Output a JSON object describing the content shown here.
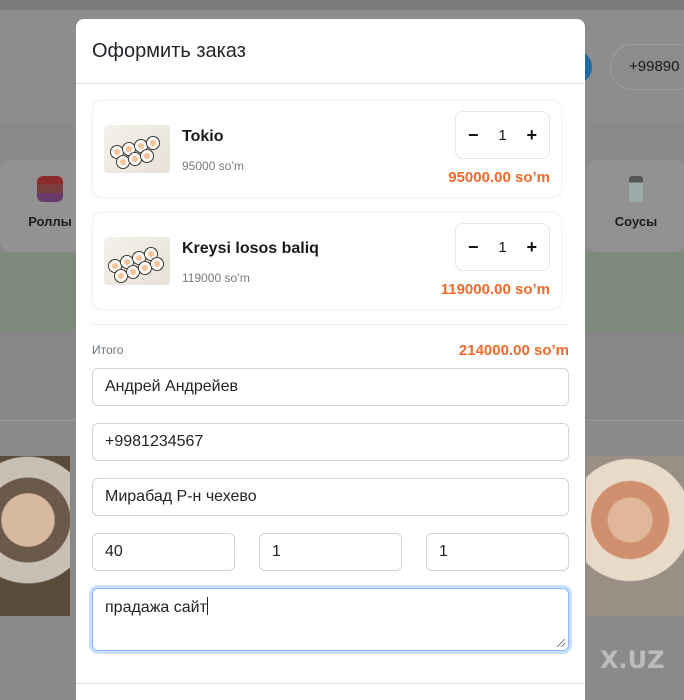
{
  "background": {
    "phone_partial": "+99890",
    "categories": [
      {
        "label": "Роллы",
        "icon": "sushi-roll-icon"
      },
      {
        "label": "Соусы",
        "icon": "sauce-bottle-icon"
      }
    ],
    "watermark": "X.UZ"
  },
  "modal": {
    "title": "Оформить заказ",
    "items": [
      {
        "name": "Tokio",
        "unit_price": "95000 so’m",
        "quantity": "1",
        "minus": "−",
        "plus": "+",
        "line_total": "95000.00 so’m"
      },
      {
        "name": "Kreysi losos baliq",
        "unit_price": "119000 so’m",
        "quantity": "1",
        "minus": "−",
        "plus": "+",
        "line_total": "119000.00 so’m"
      }
    ],
    "total_label": "Итого",
    "total_value": "214000.00 so’m",
    "form": {
      "name": "Андрей Андрейев",
      "phone": "+9981234567",
      "address": "Мирабад Р-н чехево",
      "field_a": "40",
      "field_b": "1",
      "field_c": "1",
      "comment": "прадажа сайт"
    }
  },
  "colors": {
    "accent_orange": "#f26b2d",
    "focus_blue": "#86b7fe"
  }
}
